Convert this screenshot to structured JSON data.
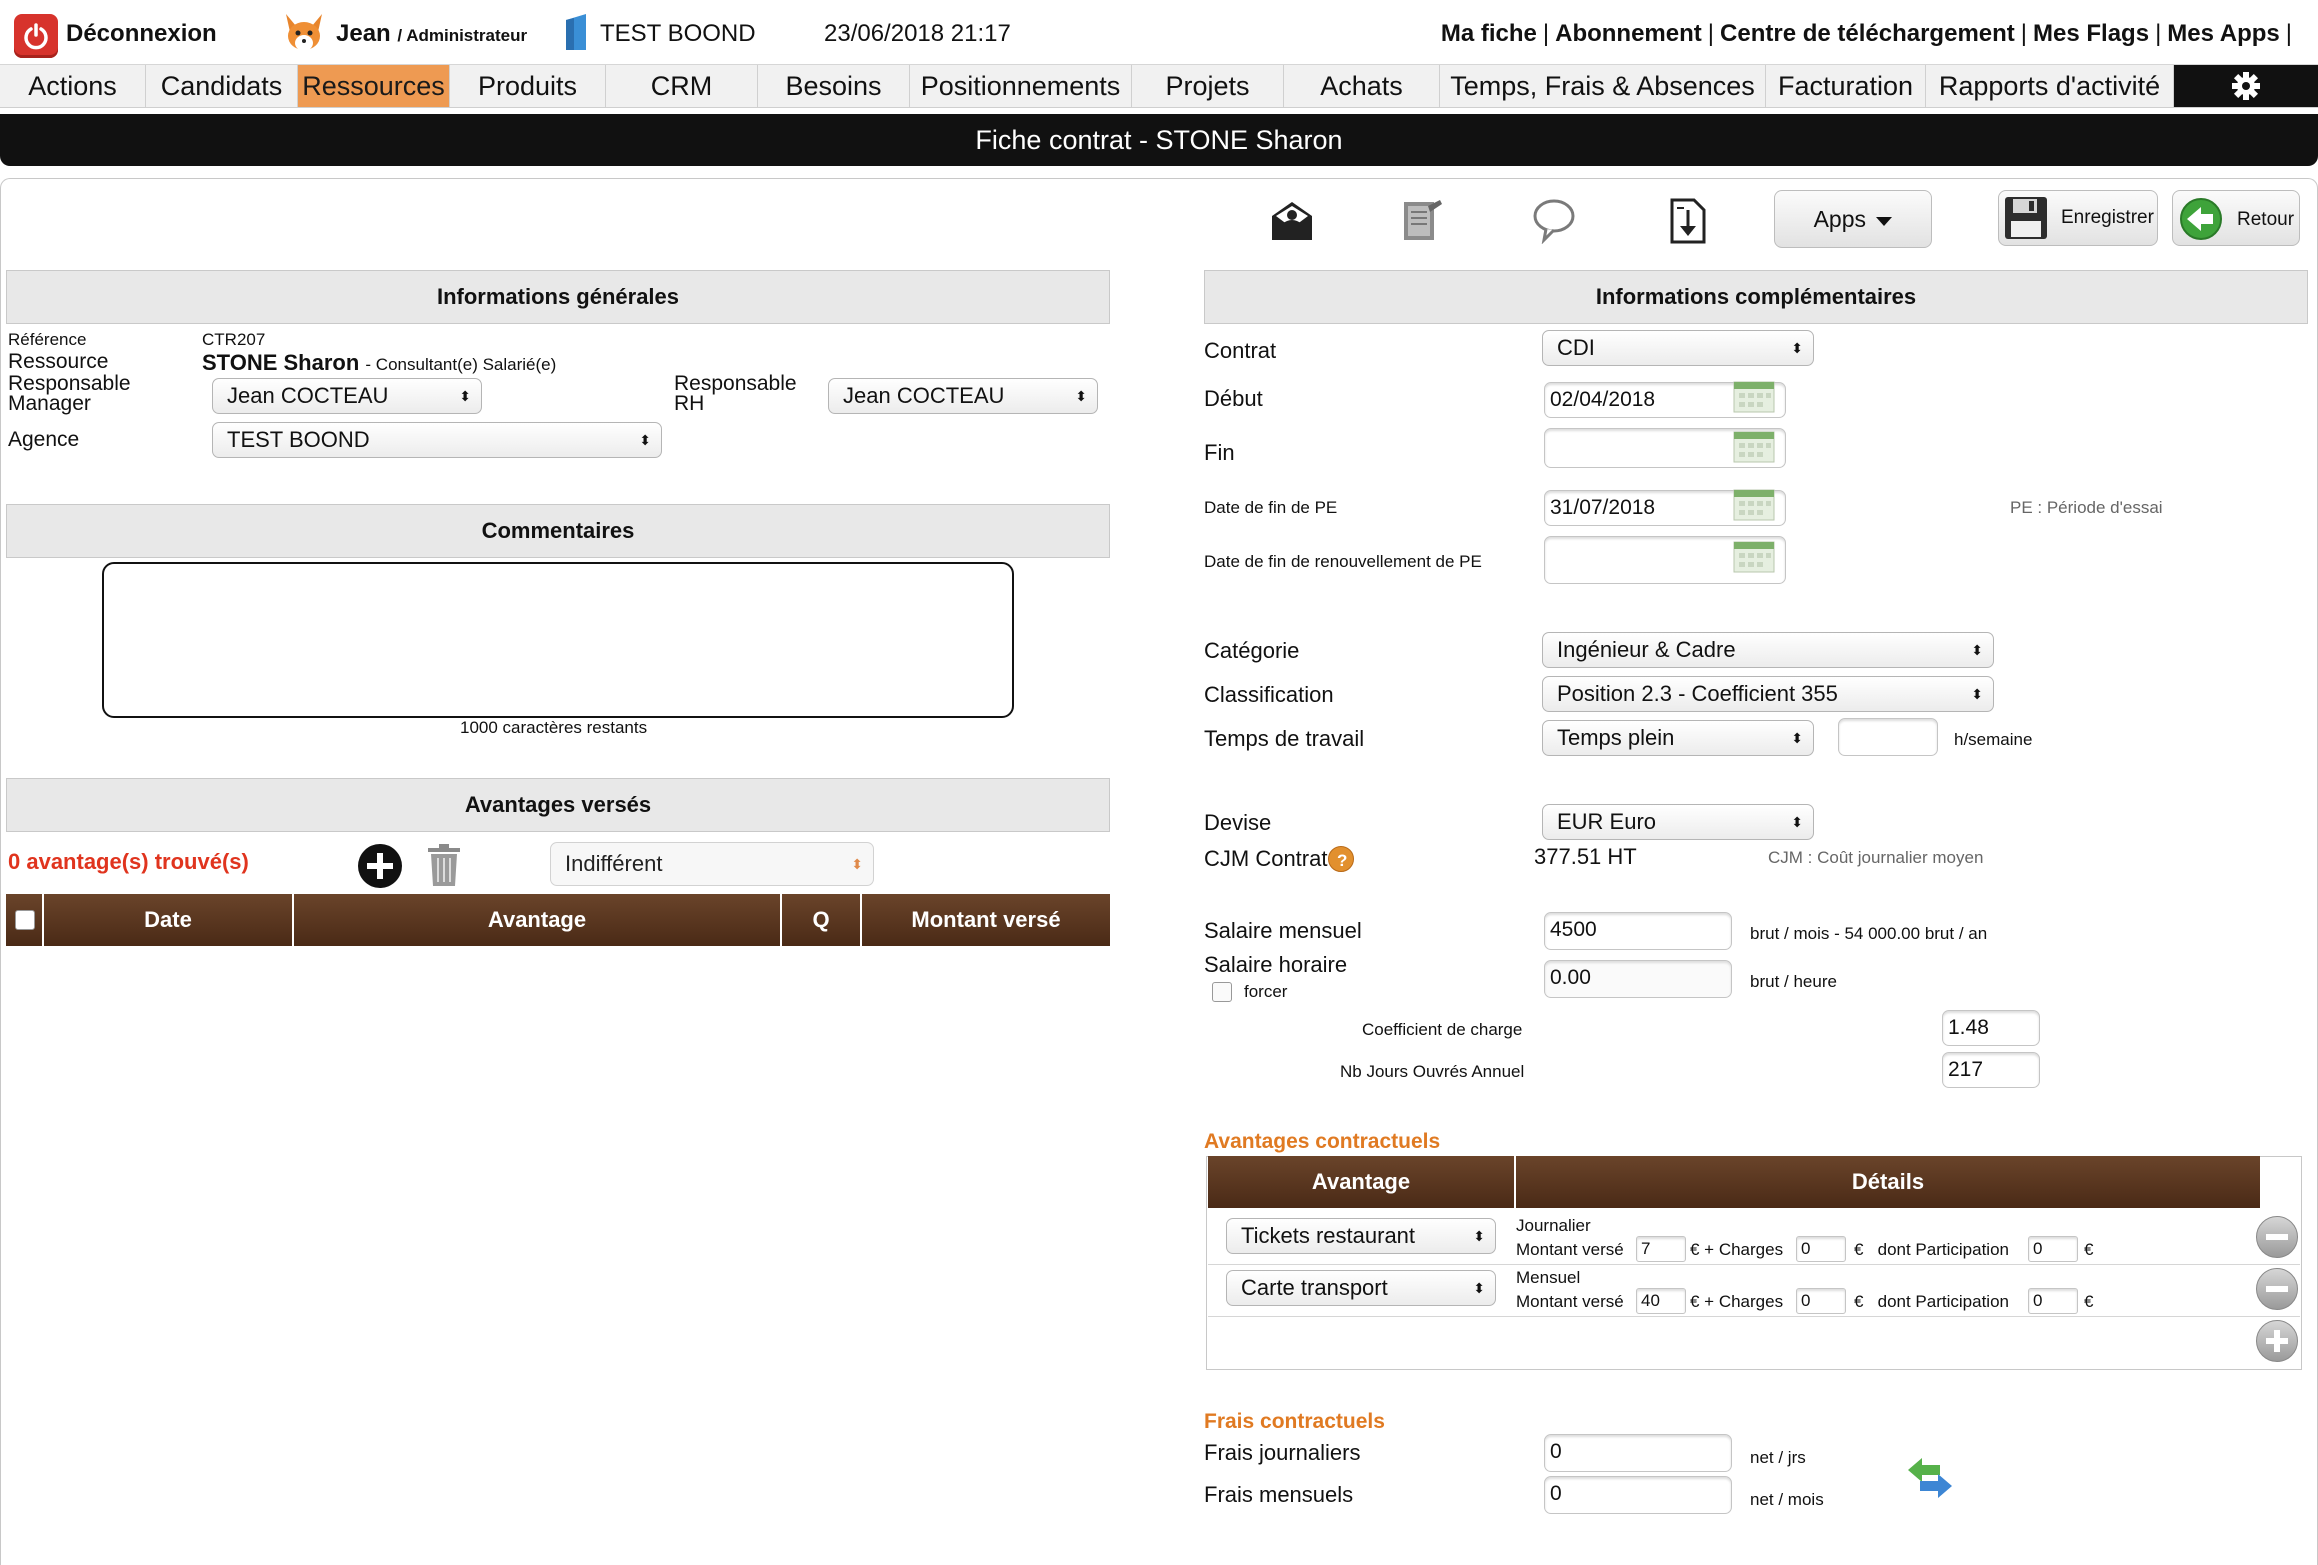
{
  "topbar": {
    "logout_label": "Déconnexion",
    "user_name": "Jean",
    "user_role": "/ Administrateur",
    "company": "TEST BOOND",
    "datetime": "23/06/2018 21:17",
    "links": [
      "Ma fiche",
      "Abonnement",
      "Centre de téléchargement",
      "Mes Flags",
      "Mes Apps"
    ],
    "separator": "|"
  },
  "nav": {
    "items": [
      "Actions",
      "Candidats",
      "Ressources",
      "Produits",
      "CRM",
      "Besoins",
      "Positionnements",
      "Projets",
      "Achats",
      "Temps, Frais & Absences",
      "Facturation",
      "Rapports d'activité"
    ],
    "active": "Ressources"
  },
  "page_title": "Fiche contrat - STONE Sharon",
  "toolbar": {
    "apps_label": "Apps",
    "save_label": "Enregistrer",
    "back_label": "Retour"
  },
  "general": {
    "header": "Informations générales",
    "reference_label": "Référence",
    "reference_value": "CTR207",
    "resource_label": "Ressource",
    "resource_name": "STONE Sharon",
    "resource_type": "- Consultant(e) Salarié(e)",
    "manager_label_1": "Responsable",
    "manager_label_2": "Manager",
    "manager_value": "Jean COCTEAU",
    "rh_label_1": "Responsable",
    "rh_label_2": "RH",
    "rh_value": "Jean COCTEAU",
    "agency_label": "Agence",
    "agency_value": "TEST BOOND"
  },
  "comments": {
    "header": "Commentaires",
    "value": "",
    "remaining": "1000 caractères restants"
  },
  "benefits_paid": {
    "header": "Avantages versés",
    "count_text": "0 avantage(s) trouvé(s)",
    "filter_value": "Indifférent",
    "columns": [
      "Date",
      "Avantage",
      "Q",
      "Montant versé"
    ]
  },
  "extra": {
    "header": "Informations complémentaires",
    "contract_label": "Contrat",
    "contract_value": "CDI",
    "start_label": "Début",
    "start_value": "02/04/2018",
    "end_label": "Fin",
    "end_value": "",
    "pe_end_label": "Date de fin de PE",
    "pe_end_value": "31/07/2018",
    "pe_note": "PE : Période d'essai",
    "pe_renew_label": "Date de fin de renouvellement de PE",
    "pe_renew_value": "",
    "category_label": "Catégorie",
    "category_value": "Ingénieur & Cadre",
    "classification_label": "Classification",
    "classification_value": "Position 2.3 - Coefficient 355",
    "worktime_label": "Temps de travail",
    "worktime_value": "Temps plein",
    "hours_value": "",
    "hours_unit": "h/semaine",
    "currency_label": "Devise",
    "currency_value": "EUR Euro",
    "cjm_label": "CJM Contrat",
    "cjm_value": "377.51 HT",
    "cjm_note": "CJM : Coût journalier moyen",
    "salary_month_label": "Salaire mensuel",
    "salary_month_value": "4500",
    "salary_month_unit": "brut / mois - 54 000.00 brut / an",
    "salary_hour_label": "Salaire horaire",
    "salary_hour_value": "0.00",
    "salary_hour_unit": "brut / heure",
    "force_label": "forcer",
    "charge_coef_label": "Coefficient de charge",
    "charge_coef_value": "1.48",
    "work_days_label": "Nb Jours Ouvrés Annuel",
    "work_days_value": "217"
  },
  "contract_benefits": {
    "title": "Avantages contractuels",
    "columns": [
      "Avantage",
      "Détails"
    ],
    "rows": [
      {
        "benefit": "Tickets restaurant",
        "period": "Journalier",
        "amount_label": "Montant versé",
        "amount": "7",
        "charges_label": "€ + Charges",
        "charges": "0",
        "participation_label": "€   dont Participation",
        "participation": "0",
        "currency": "€"
      },
      {
        "benefit": "Carte transport",
        "period": "Mensuel",
        "amount_label": "Montant versé",
        "amount": "40",
        "charges_label": "€ + Charges",
        "charges": "0",
        "participation_label": "€   dont Participation",
        "participation": "0",
        "currency": "€"
      }
    ]
  },
  "contract_fees": {
    "title": "Frais contractuels",
    "daily_label": "Frais journaliers",
    "daily_value": "0",
    "daily_unit": "net / jrs",
    "monthly_label": "Frais mensuels",
    "monthly_value": "0",
    "monthly_unit": "net / mois"
  },
  "colors": {
    "accent": "#ee9a52",
    "brown_header": "#5a3820",
    "danger": "#d7332c",
    "orange_text": "#e07a22"
  }
}
